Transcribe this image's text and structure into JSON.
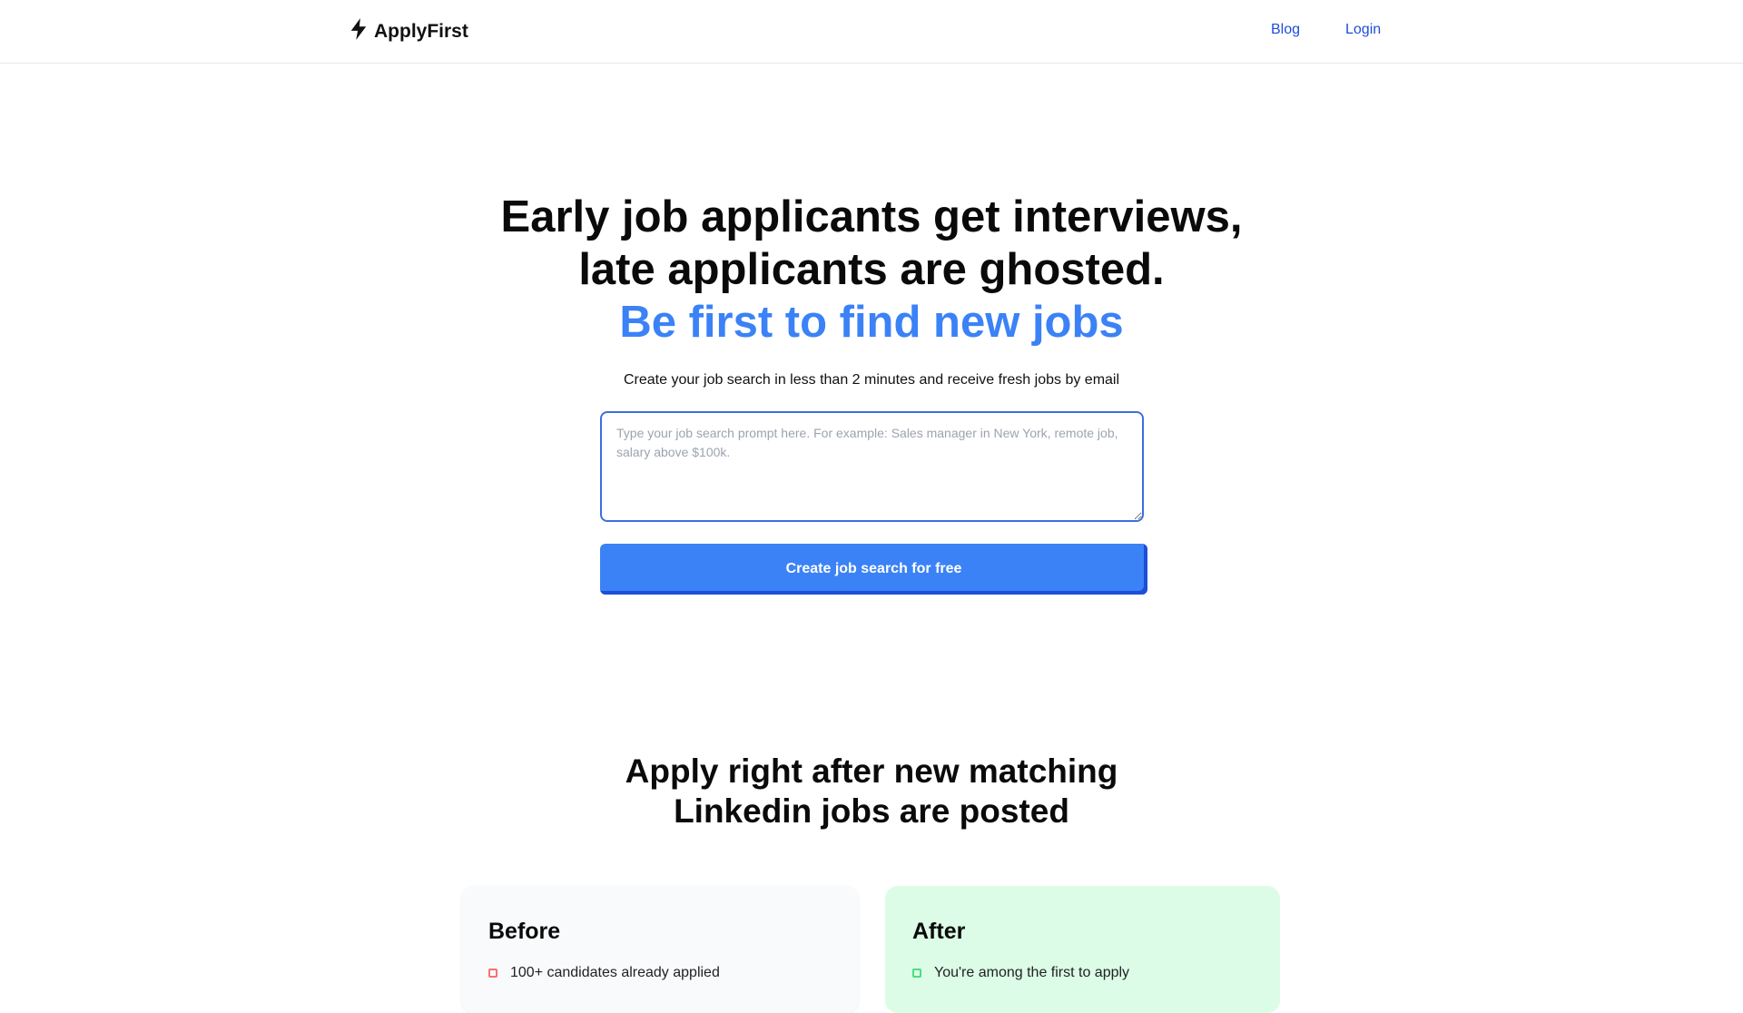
{
  "header": {
    "brand": "ApplyFirst",
    "nav": {
      "blog": "Blog",
      "login": "Login"
    }
  },
  "hero": {
    "title_line1": "Early job applicants get interviews,",
    "title_line2": "late applicants are ghosted.",
    "title_accent": "Be first to find new jobs",
    "subtitle": "Create your job search in less than 2 minutes and receive fresh jobs by email",
    "prompt": {
      "value": "",
      "placeholder": "Type your job search prompt here. For example: Sales manager in New York, remote job, salary above $100k."
    },
    "cta_label": "Create job search for free"
  },
  "section": {
    "title_line1": "Apply right after new matching",
    "title_line2": "Linkedin jobs are posted"
  },
  "comparison": {
    "before": {
      "title": "Before",
      "items": [
        "100+ candidates already applied"
      ]
    },
    "after": {
      "title": "After",
      "items": [
        "You're among the first to apply"
      ]
    }
  },
  "colors": {
    "accent": "#3b82f6",
    "link": "#1d4ed8",
    "after_card_bg": "#dcfce7",
    "before_card_bg": "#f9fafb"
  },
  "icons": {
    "brand": "lightning-bolt-icon"
  }
}
